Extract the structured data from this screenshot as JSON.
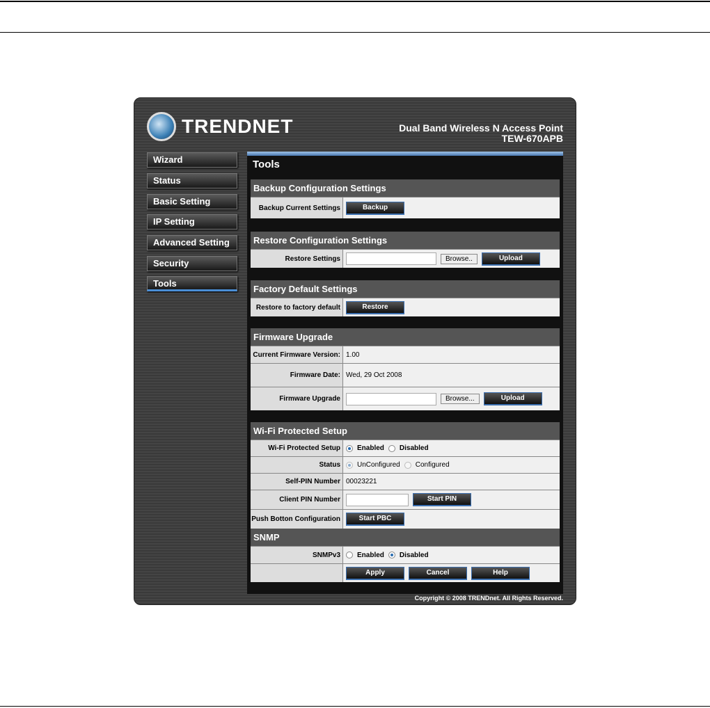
{
  "brand": {
    "logo": "TRENDNET",
    "product": "Dual Band Wireless N Access Point",
    "model": "TEW-670APB"
  },
  "nav": [
    "Wizard",
    "Status",
    "Basic Setting",
    "IP Setting",
    "Advanced Setting",
    "Security",
    "Tools"
  ],
  "page_title": "Tools",
  "backup": {
    "header": "Backup Configuration Settings",
    "label": "Backup Current Settings",
    "button": "Backup"
  },
  "restore": {
    "header": "Restore Configuration Settings",
    "label": "Restore Settings",
    "browse": "Browse..",
    "button": "Upload"
  },
  "factory": {
    "header": "Factory Default Settings",
    "label": "Restore to factory default",
    "button": "Restore"
  },
  "firmware": {
    "header": "Firmware Upgrade",
    "version_label": "Current Firmware Version:",
    "version": "1.00",
    "date_label": "Firmware Date:",
    "date": "Wed, 29 Oct 2008",
    "upgrade_label": "Firmware Upgrade",
    "browse": "Browse...",
    "button": "Upload"
  },
  "wps": {
    "header": "Wi-Fi Protected Setup",
    "wps_label": "Wi-Fi Protected Setup",
    "enabled": "Enabled",
    "disabled": "Disabled",
    "status_label": "Status",
    "unconfigured": "UnConfigured",
    "configured": "Configured",
    "selfpin_label": "Self-PIN Number",
    "selfpin": "00023221",
    "clientpin_label": "Client PIN Number",
    "start_pin": "Start PIN",
    "pbc_label": "Push Botton Configuration",
    "start_pbc": "Start PBC"
  },
  "snmp": {
    "header": "SNMP",
    "label": "SNMPv3",
    "enabled": "Enabled",
    "disabled": "Disabled"
  },
  "actions": {
    "apply": "Apply",
    "cancel": "Cancel",
    "help": "Help"
  },
  "copyright": "Copyright © 2008 TRENDnet. All Rights Reserved."
}
